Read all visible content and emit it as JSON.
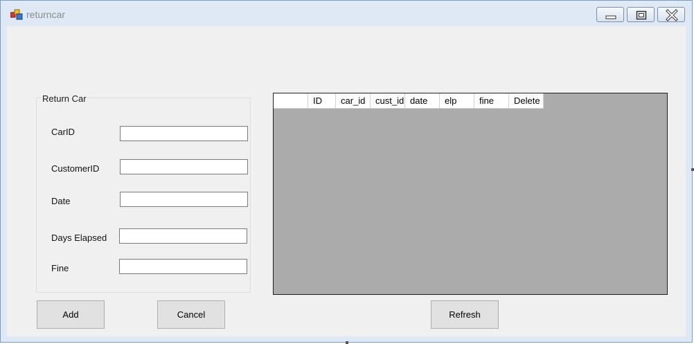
{
  "window": {
    "title": "returncar"
  },
  "form": {
    "group_title": "Return Car",
    "fields": [
      {
        "label": "CarID",
        "value": ""
      },
      {
        "label": "CustomerID",
        "value": ""
      },
      {
        "label": "Date",
        "value": ""
      },
      {
        "label": "Days Elapsed",
        "value": ""
      },
      {
        "label": "Fine",
        "value": ""
      }
    ]
  },
  "grid": {
    "columns": [
      "",
      "ID",
      "car_id",
      "cust_id",
      "date",
      "elp",
      "fine",
      "Delete"
    ]
  },
  "buttons": {
    "add": "Add",
    "cancel": "Cancel",
    "refresh": "Refresh"
  },
  "colors": {
    "grid_background": "#ababab",
    "client_background": "#f0f0f0",
    "window_frame": "#dfe9f5"
  }
}
